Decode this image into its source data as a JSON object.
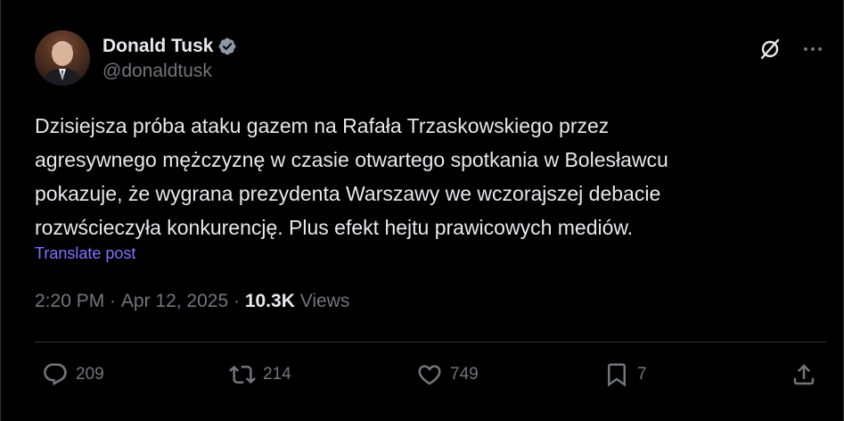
{
  "author": {
    "display_name": "Donald Tusk",
    "handle": "@donaldtusk",
    "verified": true,
    "verified_color": "#8b98a5"
  },
  "tweet": {
    "lines": [
      "Dzisiejsza próba ataku gazem na Rafała Trzaskowskiego przez",
      "agresywnego mężczyznę w czasie otwartego spotkania w Bolesławcu",
      "pokazuje, że wygrana prezydenta Warszawy we wczorajszej debacie",
      "rozwścieczyła konkurencję. Plus efekt hejtu prawicowych mediów."
    ],
    "translate_label": "Translate post"
  },
  "meta": {
    "time": "2:20 PM",
    "separator": " · ",
    "date": "Apr 12, 2025",
    "separator2": " · ",
    "views_count": "10.3K",
    "views_label": " Views"
  },
  "actions": {
    "replies": "209",
    "reposts": "214",
    "likes": "749",
    "bookmarks": "7"
  },
  "icons": {
    "grok": "grok-icon",
    "more": "more-icon",
    "reply": "reply-icon",
    "repost": "repost-icon",
    "like": "heart-icon",
    "bookmark": "bookmark-icon",
    "share": "share-icon"
  },
  "colors": {
    "background": "#000000",
    "text": "#e7e9ea",
    "secondary": "#71767b",
    "link": "#7f73ff",
    "divider": "#2f3336"
  }
}
